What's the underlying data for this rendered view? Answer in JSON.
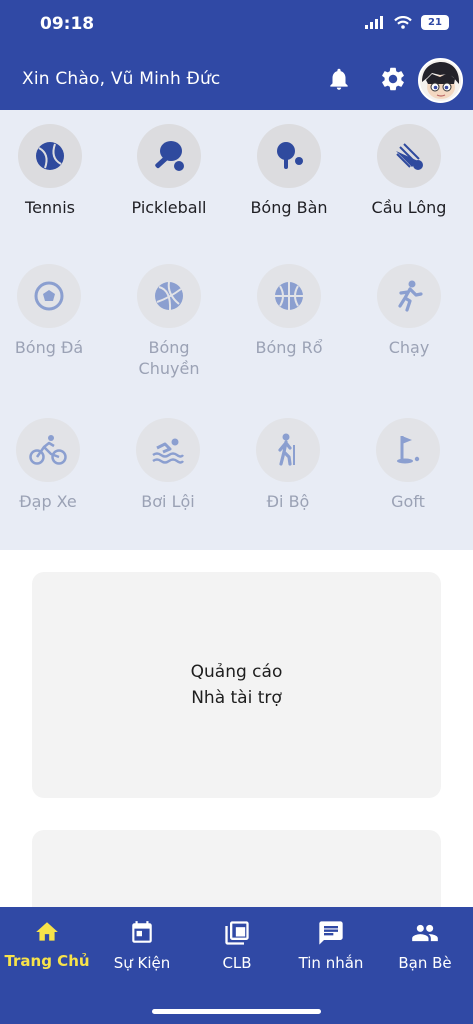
{
  "status": {
    "time": "09:18",
    "battery": "21"
  },
  "header": {
    "greeting": "Xin Chào, Vũ Minh Đức",
    "icons": [
      "bell-icon",
      "gear-icon",
      "avatar"
    ]
  },
  "sports": [
    {
      "label": "Tennis",
      "icon": "tennis-ball-icon",
      "active": true
    },
    {
      "label": "Pickleball",
      "icon": "paddle-ball-icon",
      "active": true
    },
    {
      "label": "Bóng Bàn",
      "icon": "ping-pong-icon",
      "active": true
    },
    {
      "label": "Cầu Lông",
      "icon": "shuttlecock-icon",
      "active": true
    },
    {
      "label": "Bóng Đá",
      "icon": "soccer-ball-icon",
      "active": false
    },
    {
      "label": "Bóng\nChuyền",
      "icon": "volleyball-icon",
      "active": false
    },
    {
      "label": "Bóng Rổ",
      "icon": "basketball-icon",
      "active": false
    },
    {
      "label": "Chạy",
      "icon": "running-icon",
      "active": false
    },
    {
      "label": "Đạp Xe",
      "icon": "bicycle-icon",
      "active": false
    },
    {
      "label": "Bơi Lội",
      "icon": "swimming-icon",
      "active": false
    },
    {
      "label": "Đi Bộ",
      "icon": "hiking-icon",
      "active": false
    },
    {
      "label": "Goft",
      "icon": "golf-flag-icon",
      "active": false
    }
  ],
  "ad": {
    "line1": "Quảng cáo",
    "line2": "Nhà tài trợ"
  },
  "tabs": [
    {
      "label": "Trang Chủ",
      "icon": "home-icon",
      "active": true
    },
    {
      "label": "Sự Kiện",
      "icon": "calendar-icon",
      "active": false
    },
    {
      "label": "CLB",
      "icon": "layers-icon",
      "active": false
    },
    {
      "label": "Tin nhắn",
      "icon": "chat-icon",
      "active": false
    },
    {
      "label": "Bạn Bè",
      "icon": "people-icon",
      "active": false
    }
  ],
  "colors": {
    "primary": "#3049a5",
    "active_tab": "#f7e34a",
    "sports_bg": "#e8ecf5",
    "icon_blue": "#2f4a9e"
  }
}
